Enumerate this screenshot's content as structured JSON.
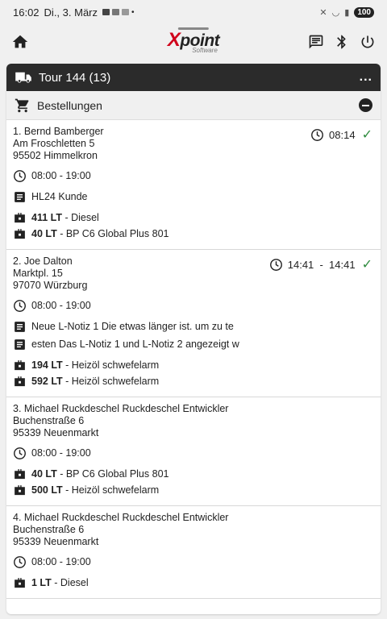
{
  "statusbar": {
    "time": "16:02",
    "date": "Di., 3. März",
    "battery": "100"
  },
  "app": {
    "logo_text": "point",
    "logo_x": "X",
    "logo_sub": "Software"
  },
  "tour": {
    "title": "Tour 144 (13)",
    "more": "..."
  },
  "orders_header": {
    "label": "Bestellungen"
  },
  "orders": [
    {
      "name": "1. Bernd Bamberger",
      "street": "Am Froschletten 5",
      "city": "95502 Himmelkron",
      "time": "08:14",
      "hours": "08:00 - 19:00",
      "notes": [
        "HL24 Kunde"
      ],
      "products": [
        {
          "qty": "411 LT",
          "desc": " - Diesel"
        },
        {
          "qty": "40 LT",
          "desc": " - BP C6 Global Plus 801"
        }
      ]
    },
    {
      "name": "2. Joe Dalton",
      "street": "Marktpl. 15",
      "city": "97070 Würzburg",
      "time": "14:41  -  14:41",
      "hours": "08:00 - 19:00",
      "notes": [
        "Neue L-Notiz 1 Die etwas länger ist. um zu te",
        "esten Das L-Notiz 1 und L-Notiz 2 angezeigt w"
      ],
      "products": [
        {
          "qty": "194 LT",
          "desc": " - Heizöl schwefelarm"
        },
        {
          "qty": "592 LT",
          "desc": " - Heizöl schwefelarm"
        }
      ]
    },
    {
      "name": "3. Michael Ruckdeschel Ruckdeschel Entwickler",
      "street": "Buchenstraße 6",
      "city": "95339 Neuenmarkt",
      "hours": "08:00 - 19:00",
      "products": [
        {
          "qty": "40 LT",
          "desc": " - BP C6 Global Plus 801"
        },
        {
          "qty": "500 LT",
          "desc": " - Heizöl schwefelarm"
        }
      ]
    },
    {
      "name": "4. Michael Ruckdeschel Ruckdeschel Entwickler",
      "street": "Buchenstraße 6",
      "city": "95339 Neuenmarkt",
      "hours": "08:00 - 19:00",
      "products": [
        {
          "qty": "1 LT",
          "desc": " - Diesel"
        }
      ]
    }
  ],
  "colors": {
    "accent_green": "#2e8b3e",
    "header_dark": "#2b2b2b",
    "logo_red": "#d0021b"
  },
  "icons": [
    "home-icon",
    "message-icon",
    "bluetooth-icon",
    "power-icon",
    "truck-icon",
    "cart-icon",
    "clock-icon",
    "note-icon",
    "product-icon",
    "check-icon"
  ]
}
